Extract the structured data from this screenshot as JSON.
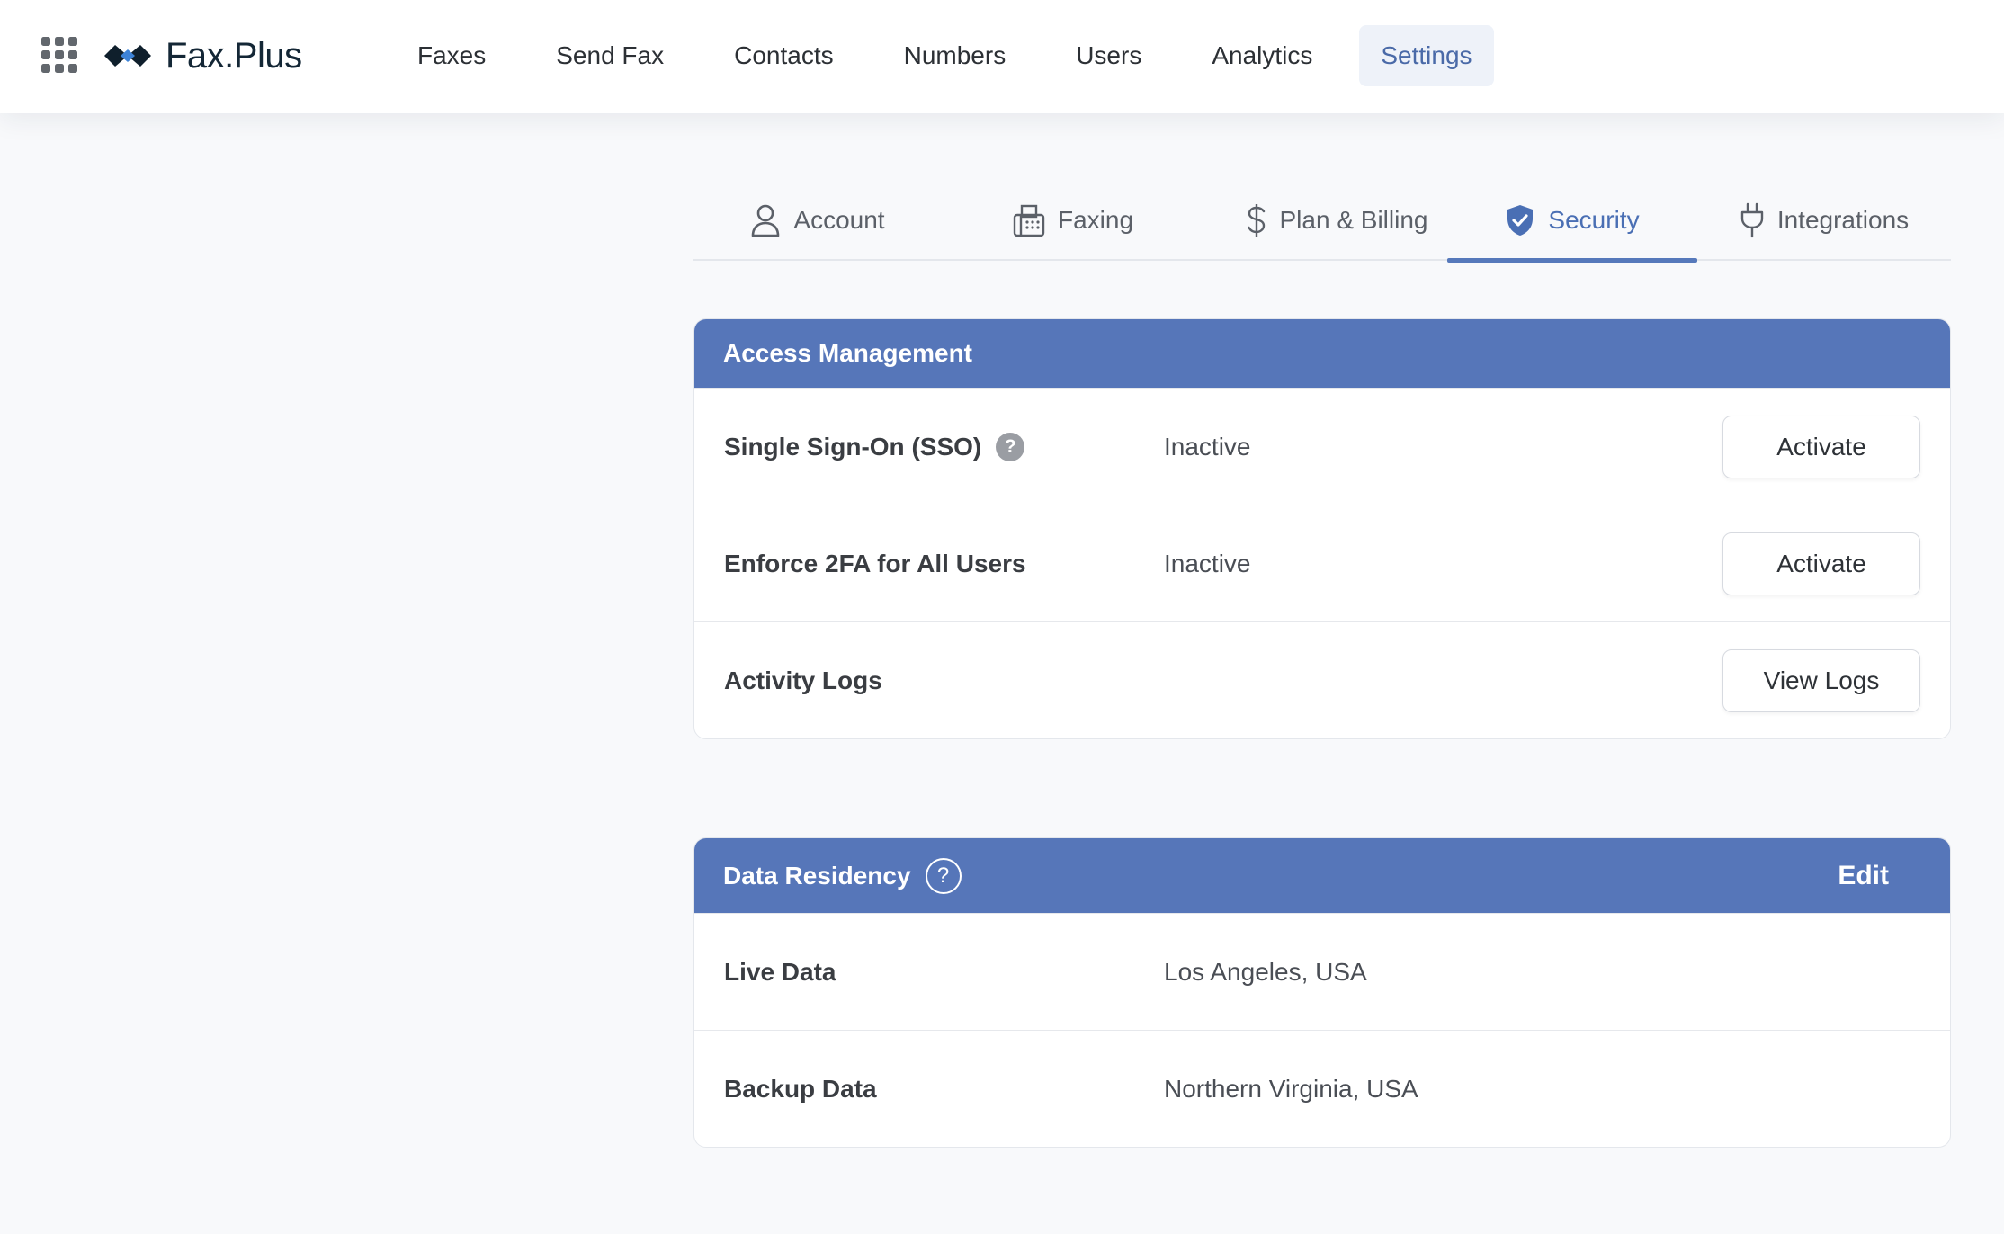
{
  "app": {
    "logo_text": "Fax.Plus",
    "apps_icon": "grid-icon",
    "colors": {
      "accent": "#5676b9",
      "active_tab": "#4a6fb4",
      "nav_active_bg": "#eef2f9",
      "background": "#f8f9fb"
    }
  },
  "nav": {
    "items": [
      {
        "label": "Faxes"
      },
      {
        "label": "Send Fax"
      },
      {
        "label": "Contacts"
      },
      {
        "label": "Numbers"
      },
      {
        "label": "Users"
      },
      {
        "label": "Analytics"
      },
      {
        "label": "Settings",
        "active": true
      }
    ]
  },
  "tabs": {
    "items": [
      {
        "label": "Account",
        "icon": "user-icon"
      },
      {
        "label": "Faxing",
        "icon": "fax-icon"
      },
      {
        "label": "Plan & Billing",
        "icon": "dollar-icon"
      },
      {
        "label": "Security",
        "icon": "shield-check-icon",
        "active": true
      },
      {
        "label": "Integrations",
        "icon": "plug-icon"
      }
    ]
  },
  "access_management": {
    "title": "Access Management",
    "rows": [
      {
        "label": "Single Sign-On (SSO)",
        "value": "Inactive",
        "button": "Activate",
        "help_icon": "question-icon"
      },
      {
        "label": "Enforce 2FA for All Users",
        "value": "Inactive",
        "button": "Activate"
      },
      {
        "label": "Activity Logs",
        "value": "",
        "button": "View Logs"
      }
    ]
  },
  "data_residency": {
    "title": "Data Residency",
    "help_icon": "question-circle-icon",
    "edit_label": "Edit",
    "rows": [
      {
        "label": "Live Data",
        "value": "Los Angeles, USA"
      },
      {
        "label": "Backup Data",
        "value": "Northern Virginia, USA"
      }
    ]
  }
}
